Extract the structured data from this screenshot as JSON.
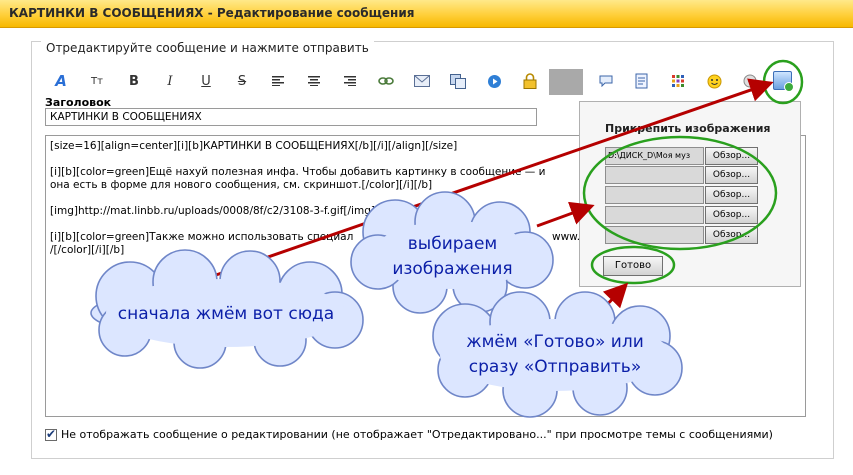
{
  "window": {
    "title": "КАРТИНКИ В СООБЩЕНИЯХ - Редактирование сообщения"
  },
  "form": {
    "legend": "Отредактируйте сообщение и нажмите отправить",
    "title_label": "Заголовок",
    "title_value": "КАРТИНКИ В СООБЩЕНИЯХ",
    "message_lines": [
      "[size=16][align=center][i][b]КАРТИНКИ В СООБЩЕНИЯХ[/b][/i][/align][/size]",
      "[i][b][color=green]Ещё нахуй полезная инфа. Чтобы добавить картинку в сообщение — и",
      "она есть в форме для нового сообщения, см. скриншот.[/color][/i][/b]",
      "[img]http://mat.linbb.ru/uploads/0008/8f/c2/3108-3-f.gif[/img]",
      "[i][b][color=green]Также можно использовать специал",
      "www.",
      "/[/color][/i][/b]"
    ],
    "checkbox_label": "Не отображать сообщение о редактировании (не отображает \"Отредактировано...\" при просмотре темы с сообщениями)",
    "checkbox_checked": true
  },
  "toolbar": {
    "icons": [
      "font-style-icon",
      "font-size-icon",
      "bold-icon",
      "italic-icon",
      "underline-icon",
      "strikethrough-icon",
      "align-left-icon",
      "align-center-icon",
      "align-right-icon",
      "link-icon",
      "email-icon",
      "copy-icon",
      "video-icon",
      "lock-icon",
      "color-picker",
      "quote-icon",
      "code-icon",
      "table-icon",
      "smiley-icon",
      "spoiler-icon",
      "attach-image-icon"
    ],
    "glyphs": {
      "font_style": "A",
      "font_size": "Tт",
      "bold": "B",
      "italic": "I",
      "underline": "U",
      "strike": "S"
    }
  },
  "attach_popup": {
    "title": "Прикрепить изображения",
    "fields": [
      {
        "value": "D:\\ДИСК_D\\Моя муз",
        "browse": "Обзор..."
      },
      {
        "value": "",
        "browse": "Обзор..."
      },
      {
        "value": "",
        "browse": "Обзор..."
      },
      {
        "value": "",
        "browse": "Обзор..."
      },
      {
        "value": "",
        "browse": "Обзор..."
      }
    ],
    "done_label": "Готово"
  },
  "annotations": {
    "cloud1": "сначала жмём вот сюда",
    "cloud2_line1": "выбираем",
    "cloud2_line2": "изображения",
    "cloud3_line1": "жмём «Готово» или",
    "cloud3_line2": "сразу «Отправить»"
  },
  "colors": {
    "titlebar": "#ffcf3a",
    "arrow": "#b50000",
    "highlight": "#2aa01e",
    "cloud_fill": "#dce6ff",
    "cloud_text": "#0b1fa8"
  }
}
